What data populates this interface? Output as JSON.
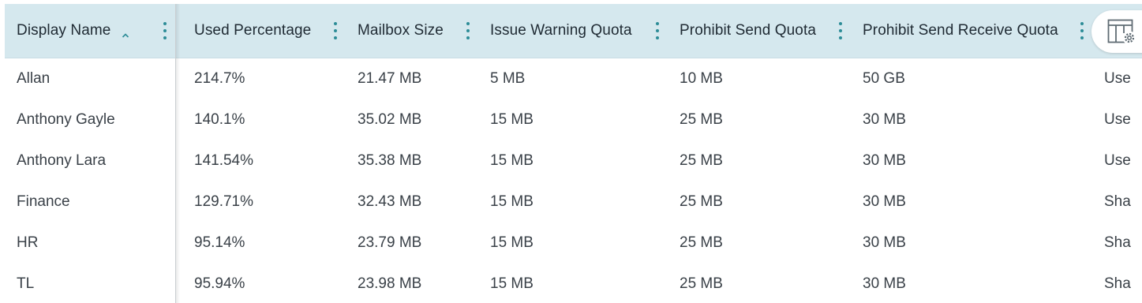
{
  "columns": [
    {
      "label": "Display Name",
      "sorted": "asc"
    },
    {
      "label": "Used Percentage"
    },
    {
      "label": "Mailbox Size"
    },
    {
      "label": "Issue Warning Quota"
    },
    {
      "label": "Prohibit Send Quota"
    },
    {
      "label": "Prohibit Send Receive Quota"
    }
  ],
  "rows": [
    {
      "display_name": "Allan",
      "used_percentage": "214.7%",
      "mailbox_size": "21.47 MB",
      "issue_warning_quota": "5 MB",
      "prohibit_send_quota": "10 MB",
      "prohibit_send_receive_quota": "50 GB",
      "overflow": "Use"
    },
    {
      "display_name": "Anthony Gayle",
      "used_percentage": "140.1%",
      "mailbox_size": "35.02 MB",
      "issue_warning_quota": "15 MB",
      "prohibit_send_quota": "25 MB",
      "prohibit_send_receive_quota": "30 MB",
      "overflow": "Use"
    },
    {
      "display_name": "Anthony Lara",
      "used_percentage": "141.54%",
      "mailbox_size": "35.38 MB",
      "issue_warning_quota": "15 MB",
      "prohibit_send_quota": "25 MB",
      "prohibit_send_receive_quota": "30 MB",
      "overflow": "Use"
    },
    {
      "display_name": "Finance",
      "used_percentage": "129.71%",
      "mailbox_size": "32.43 MB",
      "issue_warning_quota": "15 MB",
      "prohibit_send_quota": "25 MB",
      "prohibit_send_receive_quota": "30 MB",
      "overflow": "Sha"
    },
    {
      "display_name": "HR",
      "used_percentage": "95.14%",
      "mailbox_size": "23.79 MB",
      "issue_warning_quota": "15 MB",
      "prohibit_send_quota": "25 MB",
      "prohibit_send_receive_quota": "30 MB",
      "overflow": "Sha"
    },
    {
      "display_name": "TL",
      "used_percentage": "95.94%",
      "mailbox_size": "23.98 MB",
      "issue_warning_quota": "15 MB",
      "prohibit_send_quota": "25 MB",
      "prohibit_send_receive_quota": "30 MB",
      "overflow": "Sha"
    }
  ],
  "icons": {
    "sort": "chevron-up-icon",
    "column_menu": "kebab-menu-icon",
    "settings": "table-settings-icon"
  },
  "colors": {
    "header_bg": "#d5e8ee",
    "accent": "#2c8c97"
  }
}
